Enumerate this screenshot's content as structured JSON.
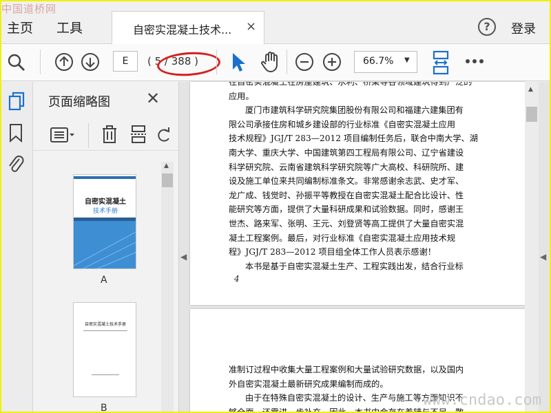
{
  "watermarks": {
    "top_left": "中国道桥网",
    "bottom_right": "www.cndao.com"
  },
  "menubar": {
    "home": "主页",
    "tools": "工具",
    "login": "登录",
    "help_icon": "help-circle-icon"
  },
  "tab": {
    "title": "自密实混凝土技术...",
    "close": "×"
  },
  "toolbar": {
    "current_page": "E",
    "page_total": "( 5 / 388 )",
    "zoom": "66.7%",
    "icons": [
      "search-icon",
      "page-up-icon",
      "page-down-icon",
      "select-cursor-icon",
      "hand-tool-icon",
      "zoom-out-icon",
      "zoom-in-icon",
      "fit-page-icon",
      "more-icon"
    ]
  },
  "sidebar": {
    "title": "页面缩略图",
    "close": "✕",
    "icons": [
      "pages-icon",
      "bookmark-icon",
      "attachment-icon"
    ],
    "tools": [
      "page-options-icon",
      "delete-icon",
      "extract-icon",
      "rotate-icon"
    ],
    "thumbnails": [
      {
        "label": "A",
        "cover_title": "自密实混凝土",
        "cover_subtitle": "技术手册"
      },
      {
        "label": "B",
        "cover_title": "自密实混凝土技术手册"
      }
    ]
  },
  "document": {
    "page1_lines": [
      "在自密实混凝土在房屋建筑、水利、桥梁等各领域建筑得到广泛的",
      "应用。",
      "厦门市建筑科学研究院集团股份有限公司和福建六建集团有",
      "限公司承接住房和城乡建设部的行业标准《自密实混凝土应用",
      "技术规程》JGJ/T 283—2012 项目编制任务后，联合中南大学、湖",
      "南大学、重庆大学、中国建筑第四工程局有限公司、辽宁省建设",
      "科学研究院、云南省建筑科学研究院等广大高校、科研院所、建",
      "设及施工单位来共同编制标准条文。非常感谢余志武、史才军、",
      "龙广成、钱觉时、孙振平等教授在自密实混凝土配合比设计、性",
      "能研究等方面，提供了大量科研成果和试验数据。同时，感谢王",
      "世杰、路来军、张明、王元、刘登贤等高工提供了大量自密实混",
      "凝土工程案例。最后，对行业标准《自密实混凝土应用技术规",
      "程》JGJ/T 283—2012 项目组全体工作人员表示感谢！",
      "本书是基于自密实混凝土生产、工程实践出发，结合行业标"
    ],
    "page1_number": "4",
    "page2_lines": [
      "准制订过程中收集大量工程案例和大量试验研究数据，以及国内",
      "外自密实混凝土最新研究成果编制而成的。",
      "由于在特殊自密实混凝土的设计、生产与施工等方面知识不",
      "够全面，还需进一步补充，因此，本书中会存在着错与不足，散"
    ]
  }
}
